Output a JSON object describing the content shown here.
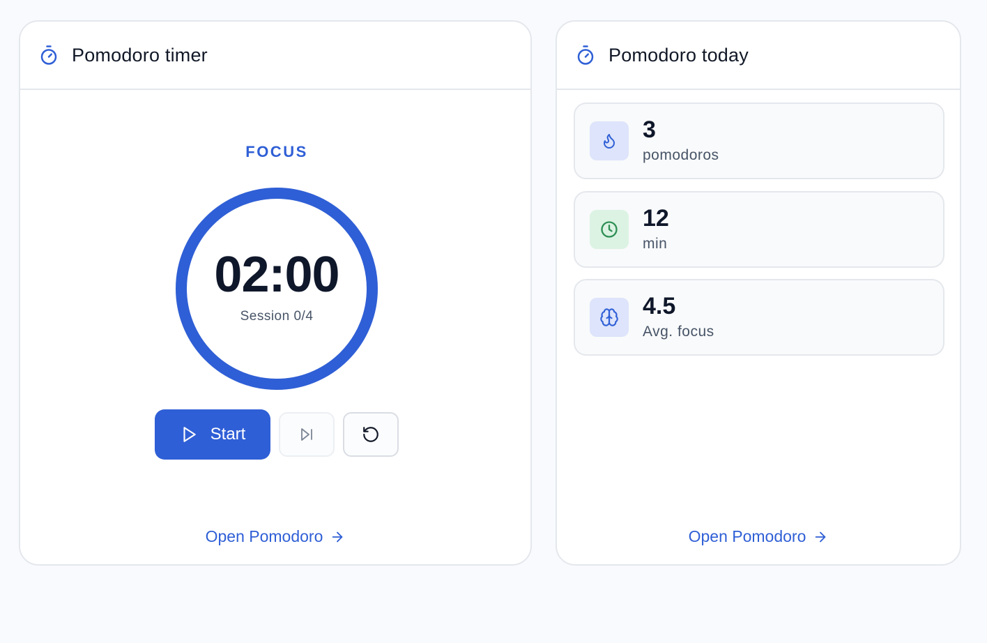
{
  "colors": {
    "accent": "#2f5fd6",
    "green": "#2f8f55",
    "border": "#e4e7ec"
  },
  "timer": {
    "title": "Pomodoro timer",
    "header_icon": "stopwatch-icon",
    "phase": "FOCUS",
    "time": "02:00",
    "session": "Session 0/4",
    "progress": 1.0,
    "start_label": "Start",
    "start_icon": "play-icon",
    "skip_icon": "skip-forward-icon",
    "reset_icon": "reset-icon",
    "link_label": "Open Pomodoro",
    "link_icon": "arrow-right-icon"
  },
  "today": {
    "title": "Pomodoro today",
    "header_icon": "stopwatch-icon",
    "stats": [
      {
        "value": "3",
        "label": "pomodoros",
        "icon": "flame-icon"
      },
      {
        "value": "12",
        "label": "min",
        "icon": "clock-icon"
      },
      {
        "value": "4.5",
        "label": "Avg. focus",
        "icon": "brain-icon"
      }
    ],
    "link_label": "Open Pomodoro",
    "link_icon": "arrow-right-icon"
  }
}
